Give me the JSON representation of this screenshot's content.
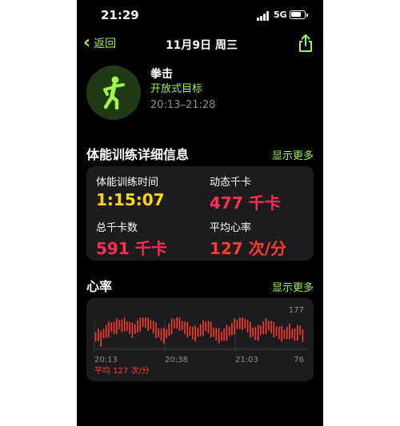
{
  "status_bar": {
    "time": "21:29",
    "network": "5G"
  },
  "nav": {
    "back_label": "返回",
    "title": "11月9日 周三"
  },
  "workout": {
    "name": "拳击",
    "goal": "开放式目标",
    "time_range": "20:13–21:28",
    "icon": "boxing-figure-icon"
  },
  "details": {
    "title": "体能训练详细信息",
    "more": "显示更多",
    "metrics": [
      {
        "label": "体能训练时间",
        "value": "1:15:07",
        "color": "#ffd60a"
      },
      {
        "label": "动态千卡",
        "value": "477 千卡",
        "color": "#ff2d55"
      },
      {
        "label": "总千卡数",
        "value": "591 千卡",
        "color": "#ff2d55"
      },
      {
        "label": "平均心率",
        "value": "127 次/分",
        "color": "#ff3b30"
      }
    ]
  },
  "heart": {
    "title": "心率",
    "more": "显示更多",
    "average": "平均 127 次/分"
  },
  "chart_data": {
    "type": "bar",
    "x_ticks": [
      "20:13",
      "20:38",
      "21:03"
    ],
    "ylim": [
      76,
      177
    ],
    "y_ticks": [
      "177",
      "76"
    ],
    "color": "#ff3b30",
    "values": [
      118,
      124,
      112,
      128,
      135,
      140,
      148,
      145,
      150,
      155,
      152,
      158,
      150,
      145,
      138,
      142,
      150,
      158,
      162,
      165,
      160,
      155,
      148,
      138,
      130,
      125,
      122,
      128,
      140,
      150,
      158,
      162,
      160,
      152,
      145,
      140,
      136,
      130,
      128,
      132,
      138,
      145,
      150,
      148,
      140,
      132,
      126,
      122,
      120,
      125,
      130,
      135,
      142,
      150,
      155,
      160,
      162,
      158,
      150,
      140,
      132,
      128,
      130,
      138,
      145,
      150,
      152,
      148,
      140,
      135,
      130,
      128,
      126,
      130,
      135,
      128,
      125,
      130,
      138,
      122
    ]
  }
}
